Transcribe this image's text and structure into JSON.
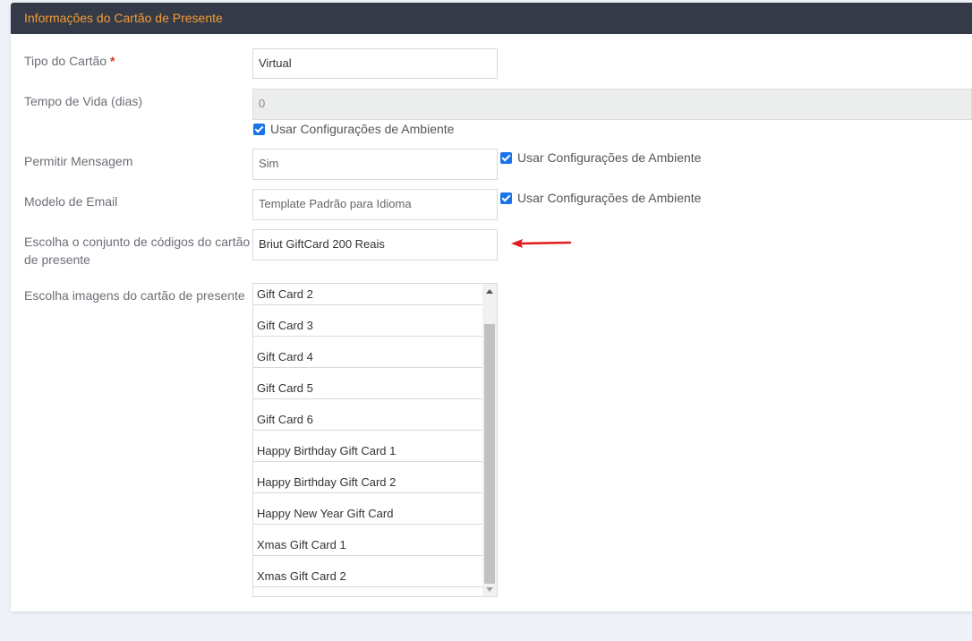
{
  "panel": {
    "title": "Informações do Cartão de Presente"
  },
  "form": {
    "card_type": {
      "label": "Tipo do Cartão",
      "required_mark": "*",
      "value": "Virtual"
    },
    "lifetime": {
      "label": "Tempo de Vida (dias)",
      "value": "0",
      "use_env_label": "Usar Configurações de Ambiente"
    },
    "allow_message": {
      "label": "Permitir Mensagem",
      "value": "Sim",
      "use_env_label": "Usar Configurações de Ambiente"
    },
    "email_template": {
      "label": "Modelo de Email",
      "value": "Template Padrão para Idioma",
      "use_env_label": "Usar Configurações de Ambiente"
    },
    "code_set": {
      "label": "Escolha o conjunto de códigos do cartão de presente",
      "value": "Briut GiftCard 200 Reais"
    },
    "images": {
      "label": "Escolha imagens do cartão de presente",
      "options": [
        "Gift Card 2",
        "Gift Card 3",
        "Gift Card 4",
        "Gift Card 5",
        "Gift Card 6",
        "Happy Birthday Gift Card 1",
        "Happy Birthday Gift Card 2",
        "Happy New Year Gift Card",
        "Xmas Gift Card 1",
        "Xmas Gift Card 2"
      ]
    }
  },
  "colors": {
    "header_bg": "#343a47",
    "header_text": "#f39c35",
    "checkbox": "#1a73e8",
    "annotation_arrow": "#e01b1b"
  }
}
